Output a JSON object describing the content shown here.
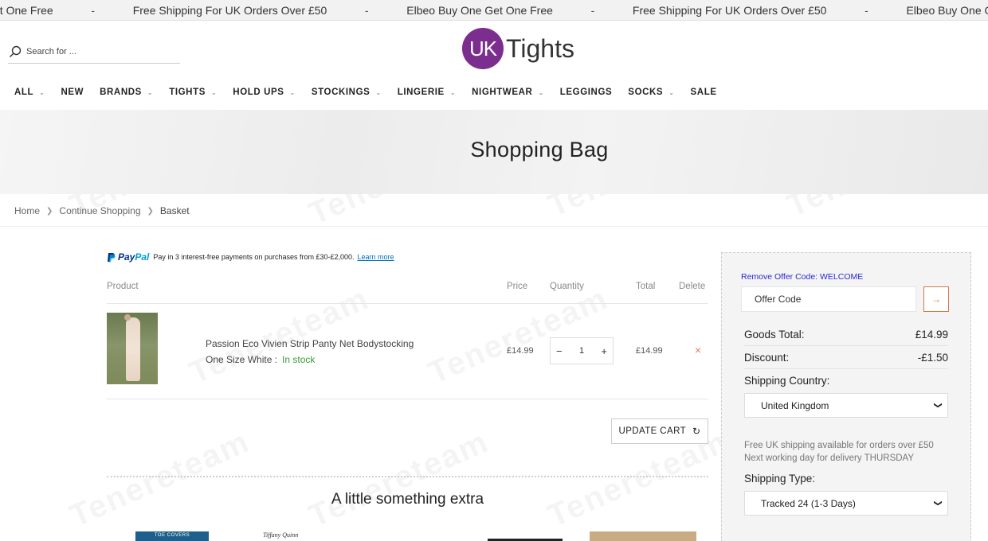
{
  "marquee": {
    "items": [
      "et One Free",
      "Free Shipping For UK Orders Over £50",
      "Elbeo Buy One Get One Free",
      "Free Shipping For UK Orders Over £50",
      "Elbeo Buy One Get O"
    ],
    "separator": "-"
  },
  "header": {
    "search_placeholder": "Search for ...",
    "logo_uk": "UK",
    "logo_word": "Tights"
  },
  "nav": [
    {
      "label": "ALL",
      "has_dropdown": true
    },
    {
      "label": "NEW",
      "has_dropdown": false
    },
    {
      "label": "BRANDS",
      "has_dropdown": true
    },
    {
      "label": "TIGHTS",
      "has_dropdown": true
    },
    {
      "label": "HOLD UPS",
      "has_dropdown": true
    },
    {
      "label": "STOCKINGS",
      "has_dropdown": true
    },
    {
      "label": "LINGERIE",
      "has_dropdown": true
    },
    {
      "label": "NIGHTWEAR",
      "has_dropdown": true
    },
    {
      "label": "LEGGINGS",
      "has_dropdown": false
    },
    {
      "label": "SOCKS",
      "has_dropdown": true
    },
    {
      "label": "SALE",
      "has_dropdown": false
    }
  ],
  "hero": {
    "title": "Shopping Bag"
  },
  "breadcrumb": [
    "Home",
    "Continue Shopping",
    "Basket"
  ],
  "paypal": {
    "brand_a": "Pay",
    "brand_b": "Pal",
    "text": "Pay in 3 interest-free payments on purchases from £30-£2,000.",
    "link": "Learn more"
  },
  "cart": {
    "headers": {
      "product": "Product",
      "price": "Price",
      "quantity": "Quantity",
      "total": "Total",
      "delete": "Delete"
    },
    "items": [
      {
        "name": "Passion Eco Vivien Strip Panty Net Bodystocking",
        "variant": "One Size White :",
        "stock": "In stock",
        "price": "£14.99",
        "quantity": "1",
        "total": "£14.99"
      }
    ],
    "update_label": "UPDATE CART",
    "minus": "−",
    "plus": "+",
    "delete_icon": "×"
  },
  "extra": {
    "title": "A little something extra",
    "thumb1_text": "TOE COVERS",
    "thumb2_text": "Tiffany Quinn"
  },
  "summary": {
    "remove_offer": "Remove Offer Code: WELCOME",
    "offer_placeholder": "Offer Code",
    "offer_button": "→",
    "goods_total_label": "Goods Total:",
    "goods_total_value": "£14.99",
    "discount_label": "Discount:",
    "discount_value": "-£1.50",
    "shipping_country_label": "Shipping Country:",
    "shipping_country_value": "United Kingdom",
    "shipping_note_1": "Free UK shipping available for orders over £50",
    "shipping_note_2": "Next working day for delivery THURSDAY",
    "shipping_type_label": "Shipping Type:",
    "shipping_type_value": "Tracked 24 (1-3 Days)"
  },
  "watermark": "Tenereteam",
  "colors": {
    "brand_purple": "#7b2e8e",
    "accent_orange": "#d07a4a",
    "in_stock_green": "#3a9a3a",
    "link_blue": "#2a2ad0"
  }
}
